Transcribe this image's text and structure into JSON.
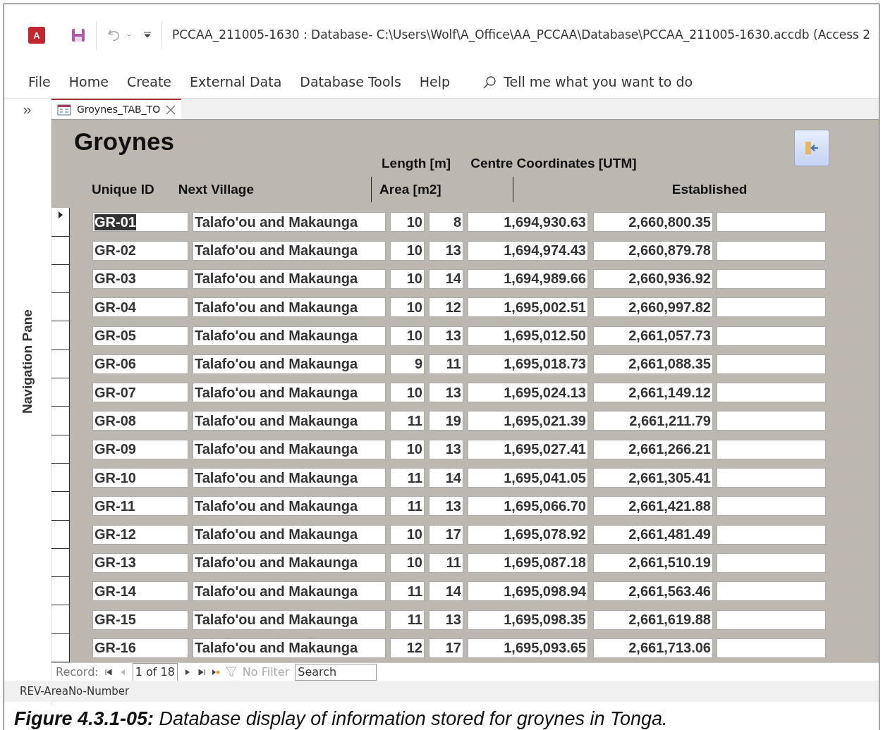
{
  "window": {
    "app_logo": "A",
    "title": "PCCAA_211005-1630 : Database- C:\\Users\\Wolf\\A_Office\\AA_PCCAA\\Database\\PCCAA_211005-1630.accdb (Access 2"
  },
  "menu": [
    {
      "label": "File",
      "selected": false
    },
    {
      "label": "Home",
      "selected": false
    },
    {
      "label": "Create",
      "selected": false
    },
    {
      "label": "External Data",
      "selected": false
    },
    {
      "label": "Database Tools",
      "selected": false
    },
    {
      "label": "Help",
      "selected": false
    }
  ],
  "tell_me": {
    "placeholder": "Tell me what you want to do"
  },
  "navigation_pane": {
    "label": "Navigation Pane"
  },
  "tabs": [
    {
      "label": "Groynes_TAB_TO",
      "selected": true
    }
  ],
  "form": {
    "title": "Groynes",
    "header_top": [
      "Length [m]",
      "Centre Coordinates [UTM]"
    ],
    "header_bottom": [
      "Unique ID",
      "Next Village",
      "Area [m2]",
      "Established"
    ],
    "rows": [
      {
        "id": "GR-01",
        "village": "Talafo'ou and Makaunga",
        "length": "10",
        "area": "8",
        "easting": "1,694,930.63",
        "northing": "2,660,800.35",
        "selected": true
      },
      {
        "id": "GR-02",
        "village": "Talafo'ou and Makaunga",
        "length": "10",
        "area": "13",
        "easting": "1,694,974.43",
        "northing": "2,660,879.78",
        "selected": false
      },
      {
        "id": "GR-03",
        "village": "Talafo'ou and Makaunga",
        "length": "10",
        "area": "14",
        "easting": "1,694,989.66",
        "northing": "2,660,936.92",
        "selected": false
      },
      {
        "id": "GR-04",
        "village": "Talafo'ou and Makaunga",
        "length": "10",
        "area": "12",
        "easting": "1,695,002.51",
        "northing": "2,660,997.82",
        "selected": false
      },
      {
        "id": "GR-05",
        "village": "Talafo'ou and Makaunga",
        "length": "10",
        "area": "13",
        "easting": "1,695,012.50",
        "northing": "2,661,057.73",
        "selected": false
      },
      {
        "id": "GR-06",
        "village": "Talafo'ou and Makaunga",
        "length": "9",
        "area": "11",
        "easting": "1,695,018.73",
        "northing": "2,661,088.35",
        "selected": false
      },
      {
        "id": "GR-07",
        "village": "Talafo'ou and Makaunga",
        "length": "10",
        "area": "13",
        "easting": "1,695,024.13",
        "northing": "2,661,149.12",
        "selected": false
      },
      {
        "id": "GR-08",
        "village": "Talafo'ou and Makaunga",
        "length": "11",
        "area": "19",
        "easting": "1,695,021.39",
        "northing": "2,661,211.79",
        "selected": false
      },
      {
        "id": "GR-09",
        "village": "Talafo'ou and Makaunga",
        "length": "10",
        "area": "13",
        "easting": "1,695,027.41",
        "northing": "2,661,266.21",
        "selected": false
      },
      {
        "id": "GR-10",
        "village": "Talafo'ou and Makaunga",
        "length": "11",
        "area": "14",
        "easting": "1,695,041.05",
        "northing": "2,661,305.41",
        "selected": false
      },
      {
        "id": "GR-11",
        "village": "Talafo'ou and Makaunga",
        "length": "11",
        "area": "13",
        "easting": "1,695,066.70",
        "northing": "2,661,421.88",
        "selected": false
      },
      {
        "id": "GR-12",
        "village": "Talafo'ou and Makaunga",
        "length": "10",
        "area": "17",
        "easting": "1,695,078.92",
        "northing": "2,661,481.49",
        "selected": false
      },
      {
        "id": "GR-13",
        "village": "Talafo'ou and Makaunga",
        "length": "10",
        "area": "11",
        "easting": "1,695,087.18",
        "northing": "2,661,510.19",
        "selected": false
      },
      {
        "id": "GR-14",
        "village": "Talafo'ou and Makaunga",
        "length": "11",
        "area": "14",
        "easting": "1,695,098.94",
        "northing": "2,661,563.46",
        "selected": false
      },
      {
        "id": "GR-15",
        "village": "Talafo'ou and Makaunga",
        "length": "11",
        "area": "13",
        "easting": "1,695,098.35",
        "northing": "2,661,619.88",
        "selected": false
      },
      {
        "id": "GR-16",
        "village": "Talafo'ou and Makaunga",
        "length": "12",
        "area": "17",
        "easting": "1,695,093.65",
        "northing": "2,661,713.06",
        "selected": false
      }
    ]
  },
  "record_nav": {
    "label": "Record:",
    "position": "1 of 18",
    "filter": "No Filter",
    "filter_disabled": true,
    "search": {
      "placeholder": "Search"
    }
  },
  "status_bar": "REV-AreaNo-Number",
  "caption": "**Figure 4.3.1-05:** Database display of information stored for groynes in Tonga."
}
